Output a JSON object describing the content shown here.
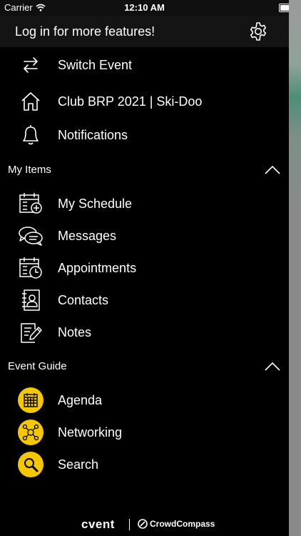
{
  "status_bar": {
    "carrier": "Carrier",
    "time": "12:10 AM"
  },
  "header": {
    "title": "Log in for more features!"
  },
  "top_items": [
    {
      "label": "Switch Event",
      "icon": "switch-arrows-icon"
    },
    {
      "label": "Club BRP 2021 | Ski-Doo",
      "icon": "home-icon"
    },
    {
      "label": "Notifications",
      "icon": "bell-icon"
    }
  ],
  "my_items": {
    "title": "My Items",
    "items": [
      {
        "label": "My Schedule",
        "icon": "calendar-add-icon"
      },
      {
        "label": "Messages",
        "icon": "chat-bubbles-icon"
      },
      {
        "label": "Appointments",
        "icon": "calendar-clock-icon"
      },
      {
        "label": "Contacts",
        "icon": "contact-book-icon"
      },
      {
        "label": "Notes",
        "icon": "note-pencil-icon"
      }
    ]
  },
  "event_guide": {
    "title": "Event Guide",
    "accent": "#f4c700",
    "items": [
      {
        "label": "Agenda",
        "icon": "agenda-calendar-icon"
      },
      {
        "label": "Networking",
        "icon": "networking-icon"
      },
      {
        "label": "Search",
        "icon": "magnifier-icon"
      }
    ]
  },
  "footer": {
    "brand": "cvent",
    "partner": "CrowdCompass"
  }
}
